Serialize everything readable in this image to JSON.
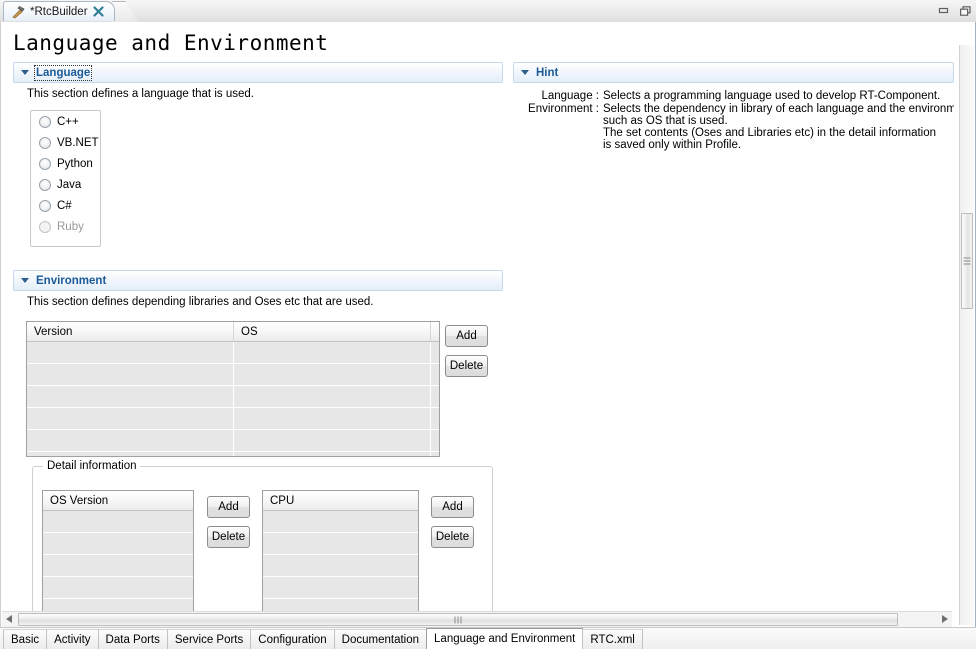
{
  "window": {
    "editor_tab": {
      "label": "*RtcBuilder",
      "icon": "hammer-icon",
      "close_icon": "close-icon"
    },
    "controls": [
      {
        "name": "minimize-button",
        "icon": "minimize-icon"
      },
      {
        "name": "restore-button",
        "icon": "restore-icon"
      }
    ]
  },
  "page": {
    "title": "Language and Environment"
  },
  "language_section": {
    "title": "Language",
    "description": "This section defines a language that is used.",
    "twistie": "chevron-down-icon",
    "options": [
      {
        "label": "C++",
        "selected": false,
        "disabled": false
      },
      {
        "label": "VB.NET",
        "selected": false,
        "disabled": false
      },
      {
        "label": "Python",
        "selected": false,
        "disabled": false
      },
      {
        "label": "Java",
        "selected": false,
        "disabled": false
      },
      {
        "label": "C#",
        "selected": false,
        "disabled": false
      },
      {
        "label": "Ruby",
        "selected": false,
        "disabled": true
      }
    ]
  },
  "environment_section": {
    "title": "Environment",
    "description": "This section defines depending libraries and Oses etc that are used.",
    "twistie": "chevron-down-icon",
    "table": {
      "columns": [
        "Version",
        "OS"
      ],
      "rows": [
        [
          "",
          ""
        ],
        [
          "",
          ""
        ],
        [
          "",
          ""
        ],
        [
          "",
          ""
        ],
        [
          "",
          ""
        ],
        [
          "",
          ""
        ]
      ]
    },
    "buttons": {
      "add": "Add",
      "delete": "Delete"
    }
  },
  "detail_information": {
    "group_label": "Detail information",
    "os_version_table": {
      "columns": [
        "OS Version"
      ],
      "rows": [
        "",
        "",
        "",
        "",
        ""
      ]
    },
    "os_version_buttons": {
      "add": "Add",
      "delete": "Delete"
    },
    "cpu_table": {
      "columns": [
        "CPU"
      ],
      "rows": [
        "",
        "",
        "",
        "",
        ""
      ]
    },
    "cpu_buttons": {
      "add": "Add",
      "delete": "Delete"
    }
  },
  "hint_section": {
    "title": "Hint",
    "twistie": "chevron-down-icon",
    "entries": [
      {
        "label": "Language :",
        "lines": [
          "Selects a programming language used to develop RT-Component."
        ]
      },
      {
        "label": "Environment :",
        "lines": [
          "Selects the dependency in library of each language and the environm",
          "such as OS that is used.",
          "The set contents (Oses and Libraries etc) in the detail information",
          "is saved only within Profile."
        ]
      }
    ]
  },
  "bottom_tabs": [
    {
      "label": "Basic",
      "active": false
    },
    {
      "label": "Activity",
      "active": false
    },
    {
      "label": "Data Ports",
      "active": false
    },
    {
      "label": "Service Ports",
      "active": false
    },
    {
      "label": "Configuration",
      "active": false
    },
    {
      "label": "Documentation",
      "active": false
    },
    {
      "label": "Language and Environment",
      "active": true
    },
    {
      "label": "RTC.xml",
      "active": false
    }
  ],
  "scrollbars": {
    "vertical": {
      "name": "vertical-scrollbar"
    },
    "horizontal": {
      "name": "horizontal-scrollbar"
    }
  },
  "colors": {
    "section_title": "#1c5a97",
    "section_bar_border": "#c6d9ec",
    "row_fill": "#e7e7e7",
    "disabled_text": "#9a9a9a"
  }
}
